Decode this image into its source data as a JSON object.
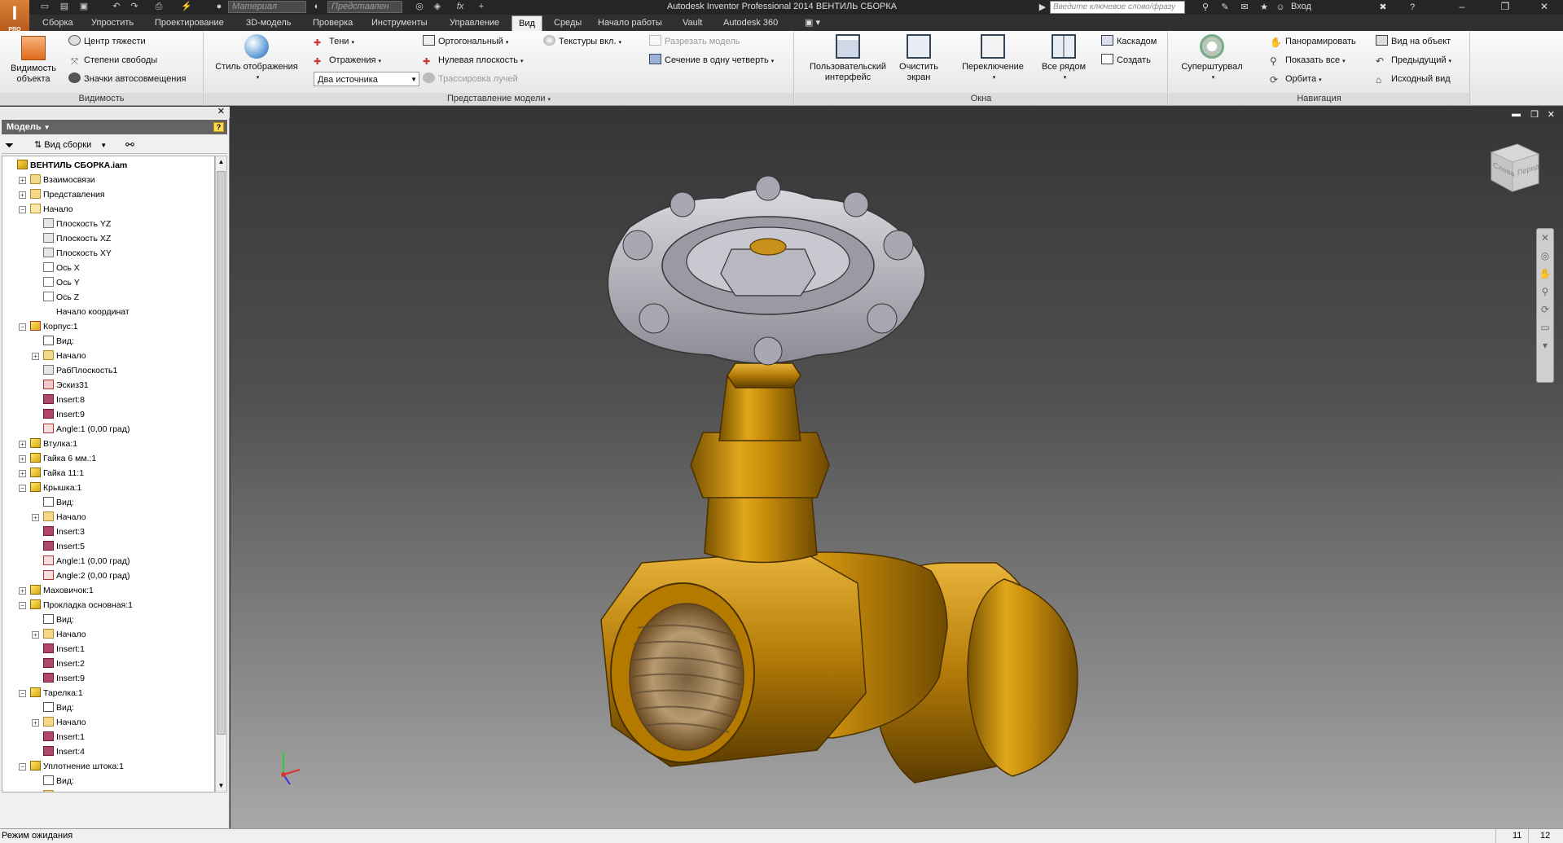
{
  "app": {
    "title": "Autodesk Inventor Professional 2014   ВЕНТИЛЬ СБОРКА",
    "logo_letter": "I",
    "logo_sub": "PRO",
    "quick_access": {
      "material": "Материал",
      "representation": "Представлен",
      "fx": "fx"
    },
    "search_placeholder": "Введите ключевое слово/фразу",
    "sign_in": "Вход"
  },
  "tabs": [
    "Сборка",
    "Упростить",
    "Проектирование",
    "3D-модель",
    "Проверка",
    "Инструменты",
    "Управление",
    "Вид",
    "Среды",
    "Начало работы",
    "Vault",
    "Autodesk 360"
  ],
  "active_tab": "Вид",
  "ribbon": {
    "visibility": {
      "label": "Видимость",
      "object_visibility": "Видимость\nобъекта",
      "center_gravity": "Центр тяжести",
      "dof": "Степени свободы",
      "auto_icons": "Значки автосовмещения"
    },
    "model_view": {
      "label": "Представление модели",
      "display_style": "Стиль отображения",
      "shadows": "Тени",
      "reflections": "Отражения",
      "light_source": "Два источника",
      "orthographic": "Ортогональный",
      "ground_plane": "Нулевая плоскость",
      "raytrace": "Трассировка лучей",
      "textures": "Текстуры вкл.",
      "cut_model": "Разрезать модель",
      "quarter_section": "Сечение в одну четверть"
    },
    "windows": {
      "label": "Окна",
      "user_interface": "Пользовательский\nинтерфейс",
      "clean_screen": "Очистить\nэкран",
      "switch": "Переключение",
      "arrange_all": "Все рядом",
      "cascade": "Каскадом",
      "new_window": "Создать"
    },
    "navigate": {
      "label": "Навигация",
      "steering_wheel": "Суперштурвал",
      "pan": "Панорамировать",
      "zoom_all": "Показать все",
      "orbit": "Орбита",
      "look_at": "Вид на объект",
      "previous": "Предыдущий",
      "home": "Исходный вид"
    }
  },
  "browser": {
    "title": "Модель",
    "view_mode": "Вид сборки",
    "nodes": [
      {
        "label": "ВЕНТИЛЬ СБОРКА.iam",
        "level": 0,
        "icon": "assembly",
        "bold": true
      },
      {
        "label": "Взаимосвязи",
        "level": 1,
        "icon": "folder",
        "expander": "+"
      },
      {
        "label": "Представления",
        "level": 1,
        "icon": "folder",
        "expander": "+"
      },
      {
        "label": "Начало",
        "level": 1,
        "icon": "folder-open",
        "expander": "-"
      },
      {
        "label": "Плоскость YZ",
        "level": 2,
        "icon": "plane"
      },
      {
        "label": "Плоскость XZ",
        "level": 2,
        "icon": "plane"
      },
      {
        "label": "Плоскость XY",
        "level": 2,
        "icon": "plane"
      },
      {
        "label": "Ось X",
        "level": 2,
        "icon": "axis"
      },
      {
        "label": "Ось Y",
        "level": 2,
        "icon": "axis"
      },
      {
        "label": "Ось Z",
        "level": 2,
        "icon": "axis"
      },
      {
        "label": "Начало координат",
        "level": 2,
        "icon": "point"
      },
      {
        "label": "Корпус:1",
        "level": 1,
        "icon": "part-grounded",
        "expander": "-"
      },
      {
        "label": "Вид:",
        "level": 2,
        "icon": "view"
      },
      {
        "label": "Начало",
        "level": 2,
        "icon": "folder",
        "expander": "+"
      },
      {
        "label": "РабПлоскость1",
        "level": 2,
        "icon": "plane"
      },
      {
        "label": "Эскиз31",
        "level": 2,
        "icon": "sketch"
      },
      {
        "label": "Insert:8",
        "level": 2,
        "icon": "constraint"
      },
      {
        "label": "Insert:9",
        "level": 2,
        "icon": "constraint"
      },
      {
        "label": "Angle:1 (0,00 град)",
        "level": 2,
        "icon": "angle"
      },
      {
        "label": "Втулка:1",
        "level": 1,
        "icon": "part",
        "expander": "+"
      },
      {
        "label": "Гайка 6 мм.:1",
        "level": 1,
        "icon": "part",
        "expander": "+"
      },
      {
        "label": "Гайка 11:1",
        "level": 1,
        "icon": "part",
        "expander": "+"
      },
      {
        "label": "Крышка:1",
        "level": 1,
        "icon": "part",
        "expander": "-"
      },
      {
        "label": "Вид:",
        "level": 2,
        "icon": "view"
      },
      {
        "label": "Начало",
        "level": 2,
        "icon": "folder",
        "expander": "+"
      },
      {
        "label": "Insert:3",
        "level": 2,
        "icon": "constraint"
      },
      {
        "label": "Insert:5",
        "level": 2,
        "icon": "constraint"
      },
      {
        "label": "Angle:1 (0,00 град)",
        "level": 2,
        "icon": "angle"
      },
      {
        "label": "Angle:2 (0,00 град)",
        "level": 2,
        "icon": "angle"
      },
      {
        "label": "Маховичок:1",
        "level": 1,
        "icon": "part",
        "expander": "+"
      },
      {
        "label": "Прокладка основная:1",
        "level": 1,
        "icon": "part",
        "expander": "-"
      },
      {
        "label": "Вид:",
        "level": 2,
        "icon": "view"
      },
      {
        "label": "Начало",
        "level": 2,
        "icon": "folder",
        "expander": "+"
      },
      {
        "label": "Insert:1",
        "level": 2,
        "icon": "constraint"
      },
      {
        "label": "Insert:2",
        "level": 2,
        "icon": "constraint"
      },
      {
        "label": "Insert:9",
        "level": 2,
        "icon": "constraint"
      },
      {
        "label": "Тарелка:1",
        "level": 1,
        "icon": "part",
        "expander": "-"
      },
      {
        "label": "Вид:",
        "level": 2,
        "icon": "view"
      },
      {
        "label": "Начало",
        "level": 2,
        "icon": "folder",
        "expander": "+"
      },
      {
        "label": "Insert:1",
        "level": 2,
        "icon": "constraint"
      },
      {
        "label": "Insert:4",
        "level": 2,
        "icon": "constraint"
      },
      {
        "label": "Уплотнение штока:1",
        "level": 1,
        "icon": "part",
        "expander": "-"
      },
      {
        "label": "Вид:",
        "level": 2,
        "icon": "view"
      },
      {
        "label": "Начало",
        "level": 2,
        "icon": "folder",
        "expander": "+"
      }
    ]
  },
  "viewcube": {
    "left": "Слева",
    "front": "Перед"
  },
  "status": {
    "text": "Режим ожидания",
    "count1": "11",
    "count2": "12"
  },
  "colors": {
    "brass": "#b8860b",
    "handwheel": "#c0c0c8",
    "accent": "#d9823a"
  }
}
